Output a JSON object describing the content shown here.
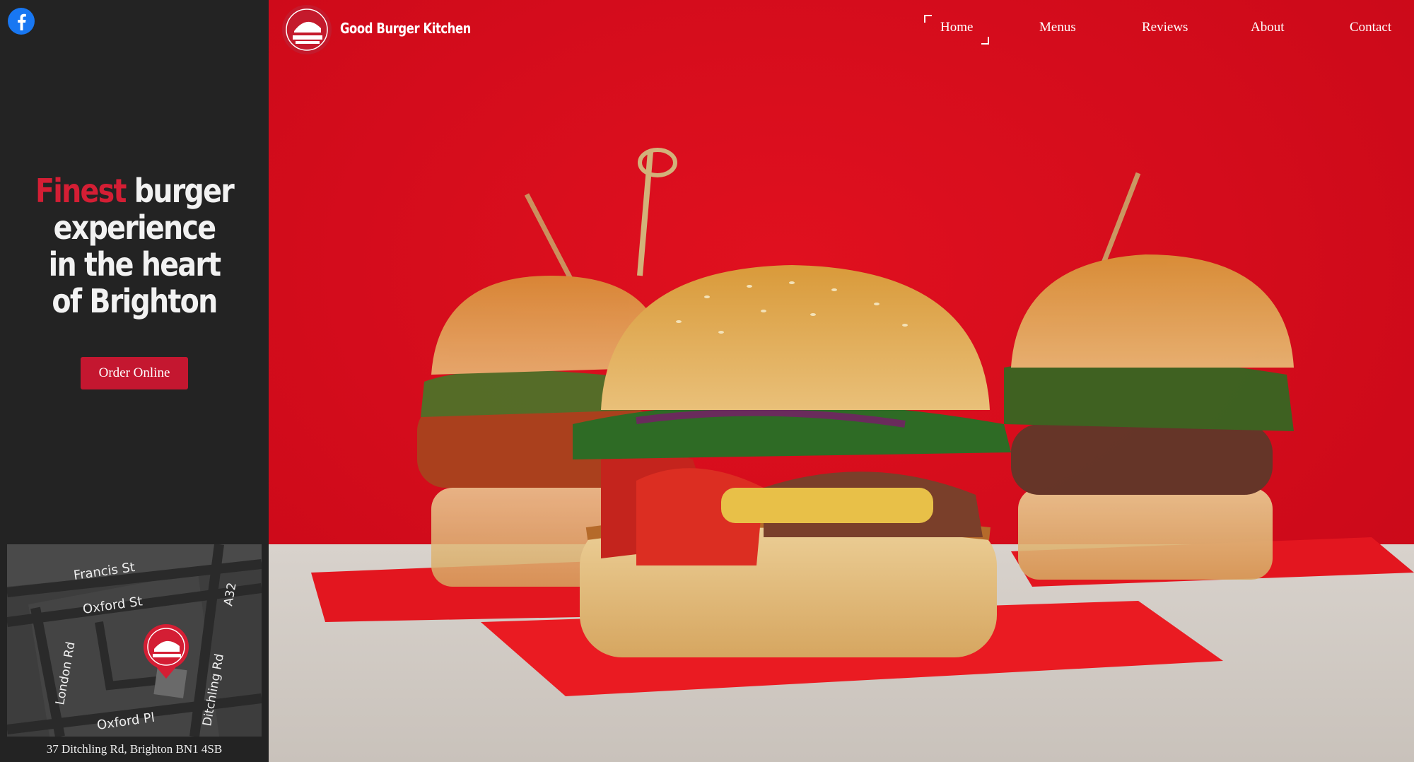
{
  "social": {
    "icon": "facebook-icon",
    "color": "#1877f2"
  },
  "header": {
    "brand": "Good Burger Kitchen",
    "logo_icon": "burger-logo-icon",
    "nav": [
      {
        "label": "Home",
        "active": true
      },
      {
        "label": "Menus"
      },
      {
        "label": "Reviews"
      },
      {
        "label": "About"
      },
      {
        "label": "Contact"
      }
    ]
  },
  "sidebar": {
    "tagline_accent": "Finest",
    "tagline_line1_rest": " burger",
    "tagline_line2": "experience",
    "tagline_line3": "in the heart",
    "tagline_line4": "of Brighton",
    "order_button": "Order Online",
    "address": "37 Ditchling Rd, Brighton BN1 4SB",
    "map": {
      "streets": [
        "Francis St",
        "Oxford St",
        "A32",
        "London Rd",
        "Ditchling Rd",
        "Oxford Pl"
      ],
      "marker_icon": "map-pin-icon"
    }
  },
  "colors": {
    "accent": "#d41e34",
    "sidebar_bg": "#232323",
    "hero_bg": "#d20a1c"
  }
}
